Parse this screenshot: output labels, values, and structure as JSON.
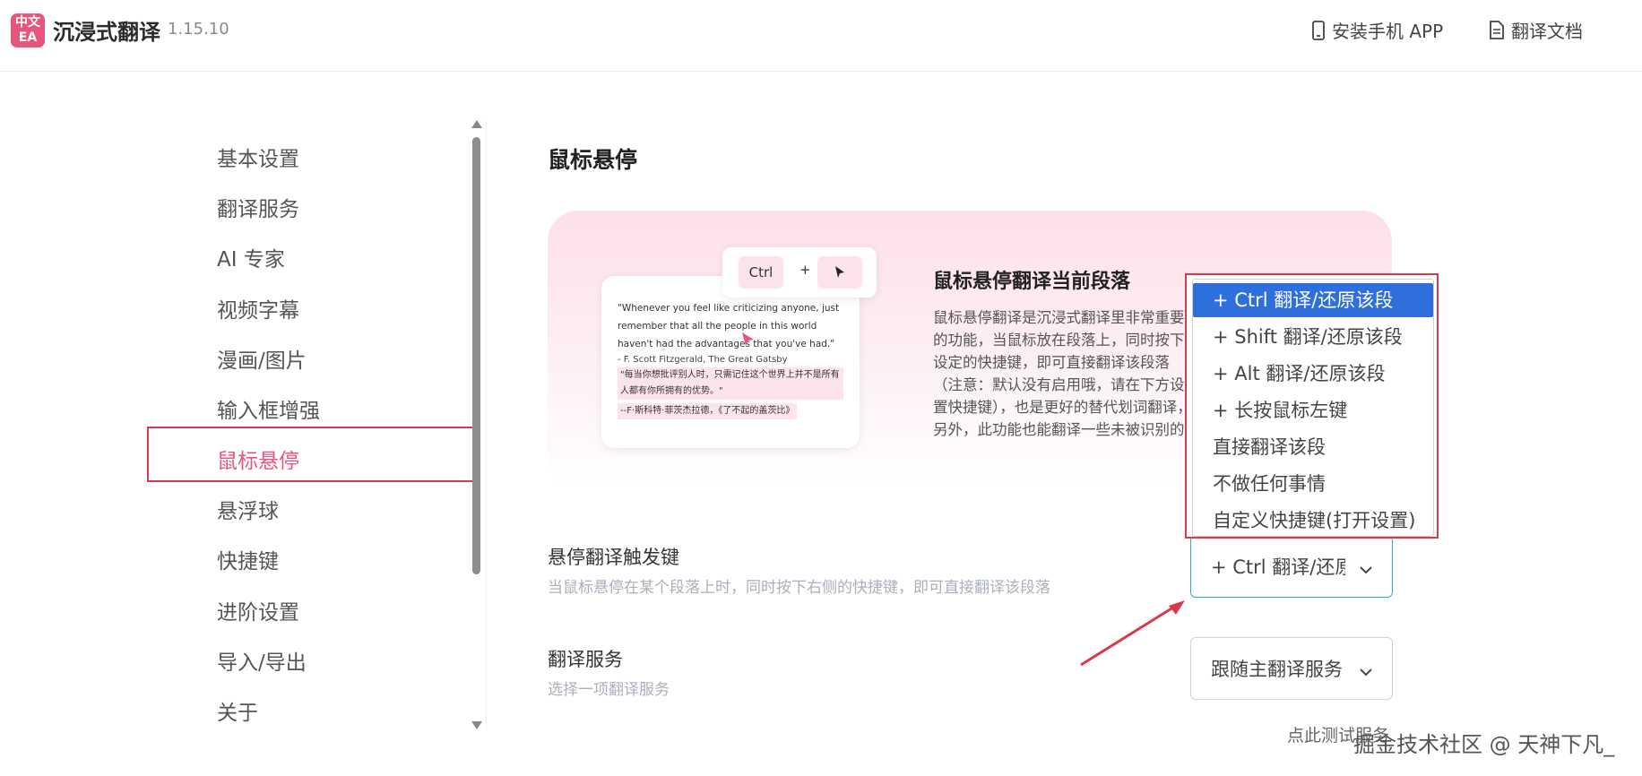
{
  "header": {
    "logo_line1": "中文",
    "logo_line2": "EA",
    "title": "沉浸式翻译",
    "version": "1.15.10",
    "install_app": "安装手机 APP",
    "docs": "翻译文档"
  },
  "sidebar": {
    "items": [
      {
        "label": "基本设置"
      },
      {
        "label": "翻译服务"
      },
      {
        "label": "AI 专家"
      },
      {
        "label": "视频字幕"
      },
      {
        "label": "漫画/图片"
      },
      {
        "label": "输入框增强"
      },
      {
        "label": "鼠标悬停"
      },
      {
        "label": "悬浮球"
      },
      {
        "label": "快捷键"
      },
      {
        "label": "进阶设置"
      },
      {
        "label": "导入/导出"
      },
      {
        "label": "关于"
      }
    ],
    "active_index": 6
  },
  "main": {
    "section_title": "鼠标悬停",
    "demo": {
      "key_ctrl": "Ctrl",
      "key_plus": "+",
      "quote": "\"Whenever you feel like criticizing anyone, just remember that all the people in this world haven't had the advantages that you've had.\"",
      "attribution": "- F. Scott Fitzgerald, The Great Gatsby",
      "translation_1": "\"每当你想批评别人时，只需记住这个世界上并不是所有人都有你所拥有的优势。\"",
      "translation_2": "--F·斯科特·菲茨杰拉德，《了不起的盖茨比》"
    },
    "feature_heading": "鼠标悬停翻译当前段落",
    "feature_desc": "鼠标悬停翻译是沉浸式翻译里非常重要的功能，当鼠标放在段落上，同时按下设定的快捷键，即可直接翻译该段落（注意：默认没有启用哦，请在下方设置快捷键），也是更好的替代划词翻译，另外，此功能也能翻译一些未被识别的翻译区域，你可以利用该功能翻译任何段落。",
    "trigger": {
      "label": "悬停翻译触发键",
      "desc": "当鼠标悬停在某个段落上时，同时按下右侧的快捷键，即可直接翻译该段落",
      "value": "+ Ctrl 翻译/还原该段"
    },
    "service": {
      "label": "翻译服务",
      "desc": "选择一项翻译服务",
      "value": "跟随主翻译服务"
    },
    "dropdown": {
      "options": [
        "+ Ctrl 翻译/还原该段",
        "+ Shift 翻译/还原该段",
        "+ Alt 翻译/还原该段",
        "+ 长按鼠标左键",
        "直接翻译该段",
        "不做任何事情",
        "自定义快捷键(打开设置)"
      ],
      "selected_index": 0
    },
    "test_link": "点此测试服务"
  },
  "watermark": "掘金技术社区 @ 天神下凡_",
  "colors": {
    "accent": "#e8557c",
    "highlight_box": "#d93a4a",
    "selected_option": "#2f6fdc",
    "focus_border": "#3aa8c2"
  }
}
